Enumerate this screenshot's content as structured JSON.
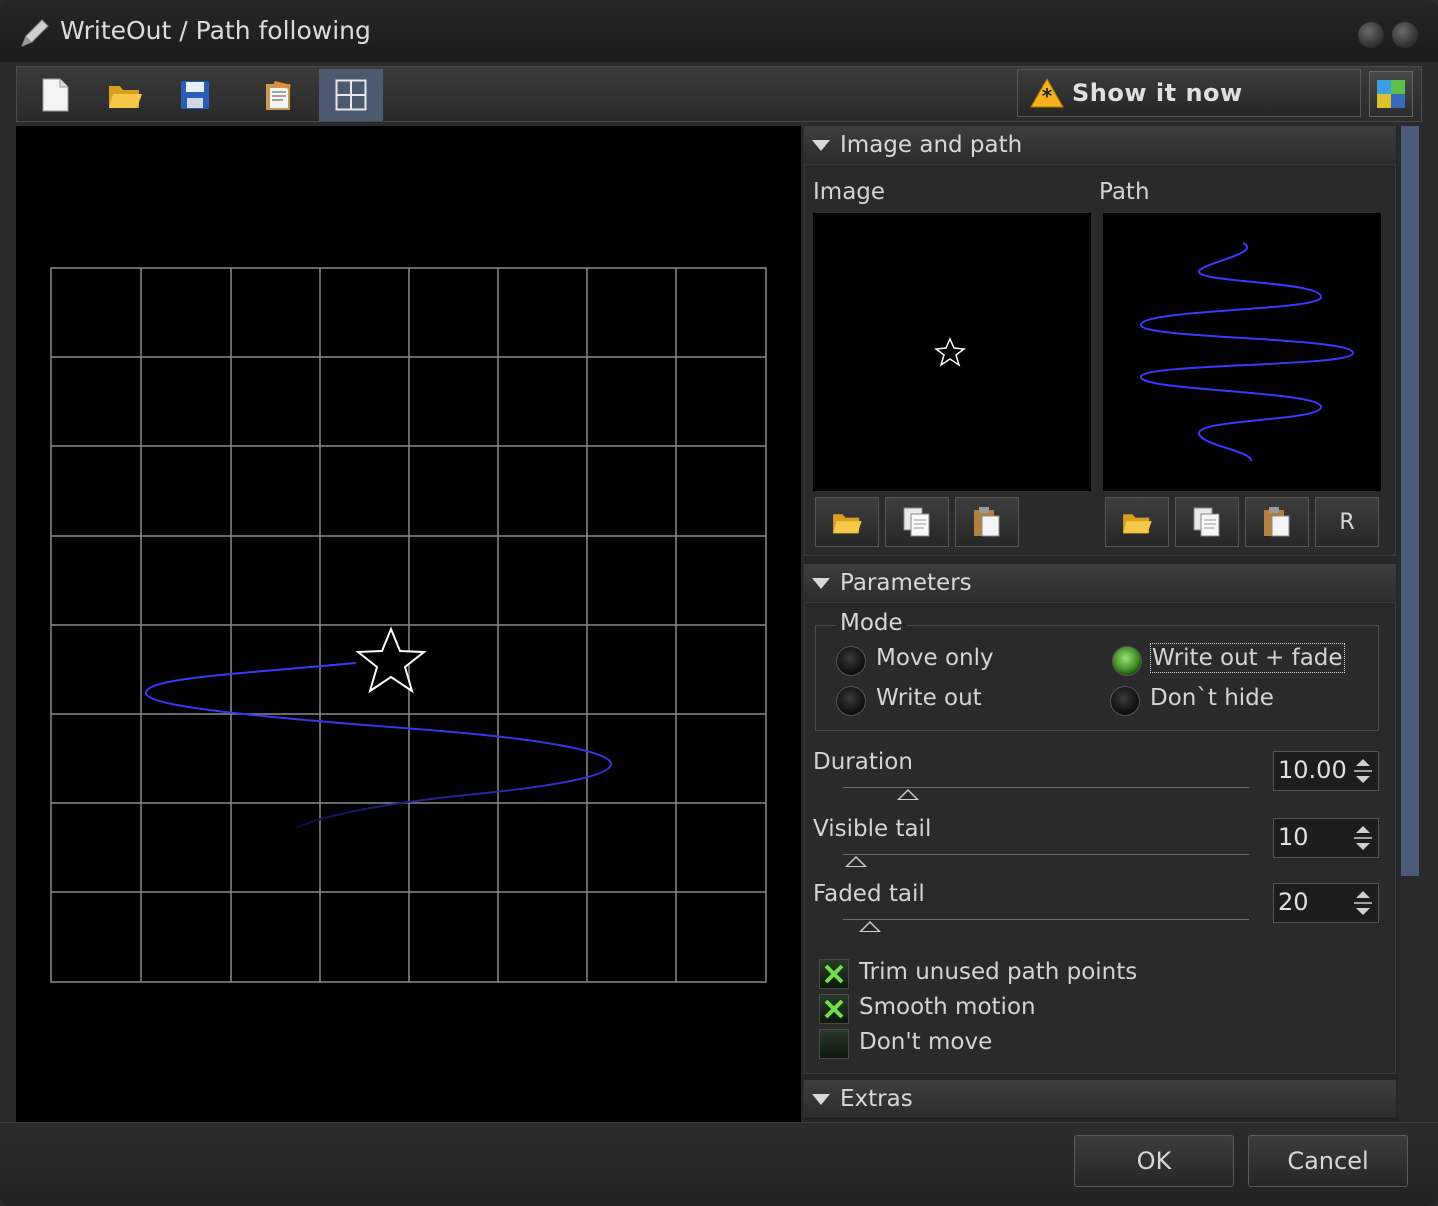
{
  "window": {
    "title": "WriteOut / Path following"
  },
  "toolbar": {
    "buttons": [
      {
        "name": "new-file-icon"
      },
      {
        "name": "open-folder-icon"
      },
      {
        "name": "save-icon"
      },
      {
        "name": "clipboard-icon"
      },
      {
        "name": "grid-icon"
      }
    ],
    "show_now_label": "Show it now",
    "show_now_icon": "warning-icon",
    "right_icon": "layout-icon"
  },
  "image_and_path": {
    "header": "Image and path",
    "image_label": "Image",
    "path_label": "Path",
    "path_reset_label": "R"
  },
  "parameters": {
    "header": "Parameters",
    "mode": {
      "legend": "Mode",
      "options": [
        {
          "label": "Move only",
          "checked": false
        },
        {
          "label": "Write out + fade",
          "checked": true
        },
        {
          "label": "Write out",
          "checked": false
        },
        {
          "label": "Don`t hide",
          "checked": false
        }
      ]
    },
    "duration": {
      "label": "Duration",
      "value": "10.00",
      "level": 0.17
    },
    "visible_tail": {
      "label": "Visible tail",
      "value": "10",
      "level": 0.03
    },
    "faded_tail": {
      "label": "Faded tail",
      "value": "20",
      "level": 0.06
    },
    "checkboxes": [
      {
        "label": "Trim unused path points",
        "checked": true
      },
      {
        "label": "Smooth motion",
        "checked": true
      },
      {
        "label": "Don't move",
        "checked": false
      }
    ]
  },
  "extras": {
    "header": "Extras"
  },
  "footer": {
    "ok_label": "OK",
    "cancel_label": "Cancel"
  },
  "colors": {
    "path": "#3a3aff",
    "accent": "#4b5a6e",
    "radio_on": "#5fc03a"
  }
}
